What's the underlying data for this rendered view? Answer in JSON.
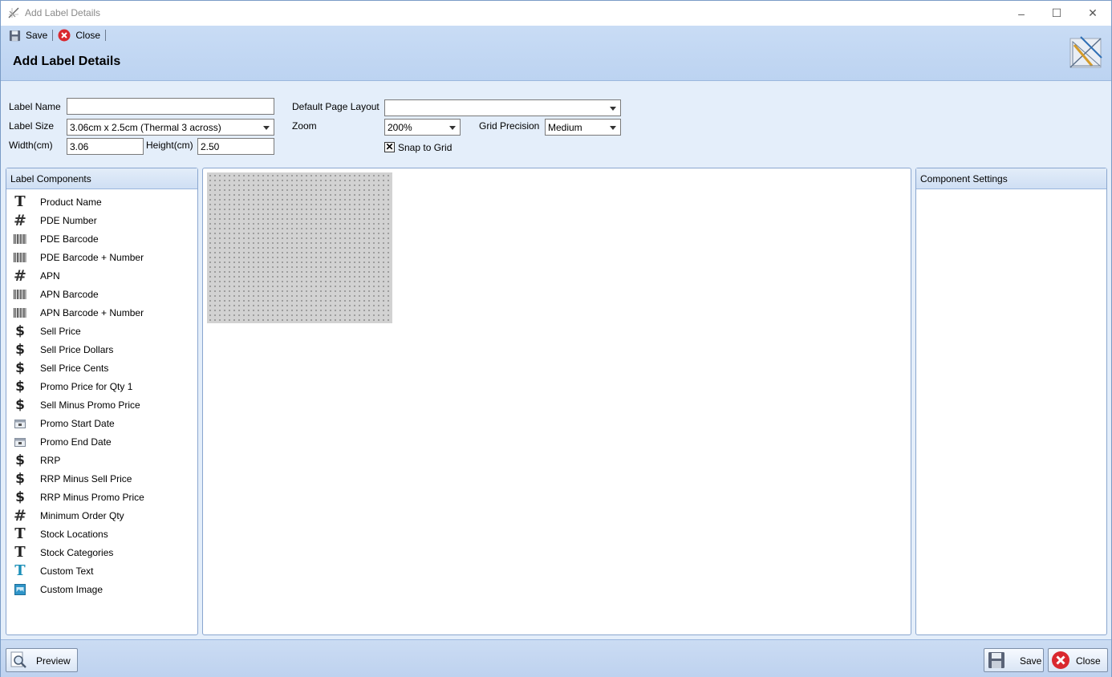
{
  "window": {
    "title": "Add Label Details",
    "minimize": "–",
    "maximize": "☐",
    "close": "✕"
  },
  "toolbar": {
    "save_label": "Save",
    "close_label": "Close"
  },
  "header": {
    "title": "Add Label Details"
  },
  "form": {
    "label_name": {
      "label": "Label Name",
      "value": ""
    },
    "label_size": {
      "label": "Label Size",
      "value": "3.06cm x 2.5cm (Thermal 3 across)"
    },
    "width": {
      "label": "Width(cm)",
      "value": "3.06"
    },
    "height": {
      "label": "Height(cm)",
      "value": "2.50"
    },
    "default_page_layout": {
      "label": "Default Page Layout",
      "value": ""
    },
    "zoom": {
      "label": "Zoom",
      "value": "200%"
    },
    "grid_precision": {
      "label": "Grid Precision",
      "value": "Medium"
    },
    "snap_to_grid": {
      "label": "Snap to Grid",
      "checked": true,
      "mark": "✕"
    }
  },
  "label_components": {
    "header": "Label Components",
    "items": [
      {
        "label": "Product Name",
        "icon": "text-icon"
      },
      {
        "label": "PDE Number",
        "icon": "hash-icon"
      },
      {
        "label": "PDE Barcode",
        "icon": "barcode-icon"
      },
      {
        "label": "PDE Barcode + Number",
        "icon": "barcode-icon"
      },
      {
        "label": "APN",
        "icon": "hash-icon"
      },
      {
        "label": "APN Barcode",
        "icon": "barcode-icon"
      },
      {
        "label": "APN Barcode + Number",
        "icon": "barcode-icon"
      },
      {
        "label": "Sell Price",
        "icon": "dollar-icon"
      },
      {
        "label": "Sell Price Dollars",
        "icon": "dollar-icon"
      },
      {
        "label": "Sell Price Cents",
        "icon": "dollar-icon"
      },
      {
        "label": "Promo Price for Qty 1",
        "icon": "dollar-icon"
      },
      {
        "label": "Sell Minus Promo Price",
        "icon": "dollar-icon"
      },
      {
        "label": "Promo Start Date",
        "icon": "calendar-icon"
      },
      {
        "label": "Promo End Date",
        "icon": "calendar-icon"
      },
      {
        "label": "RRP",
        "icon": "dollar-icon"
      },
      {
        "label": "RRP Minus Sell Price",
        "icon": "dollar-icon"
      },
      {
        "label": "RRP Minus Promo Price",
        "icon": "dollar-icon"
      },
      {
        "label": "Minimum Order Qty",
        "icon": "hash-icon"
      },
      {
        "label": "Stock Locations",
        "icon": "text-icon"
      },
      {
        "label": "Stock Categories",
        "icon": "text-icon"
      },
      {
        "label": "Custom Text",
        "icon": "custom-text-icon"
      },
      {
        "label": "Custom Image",
        "icon": "image-icon"
      }
    ]
  },
  "component_settings": {
    "header": "Component Settings"
  },
  "footer": {
    "preview_label": "Preview",
    "save_label": "Save",
    "close_label": "Close"
  },
  "colors": {
    "header_bg": "#c9dcf5",
    "form_bg": "#e4eefa",
    "grid_bg": "#d2d2d2",
    "close_red": "#d9282f",
    "custom_text_blue": "#1b8fb8"
  }
}
